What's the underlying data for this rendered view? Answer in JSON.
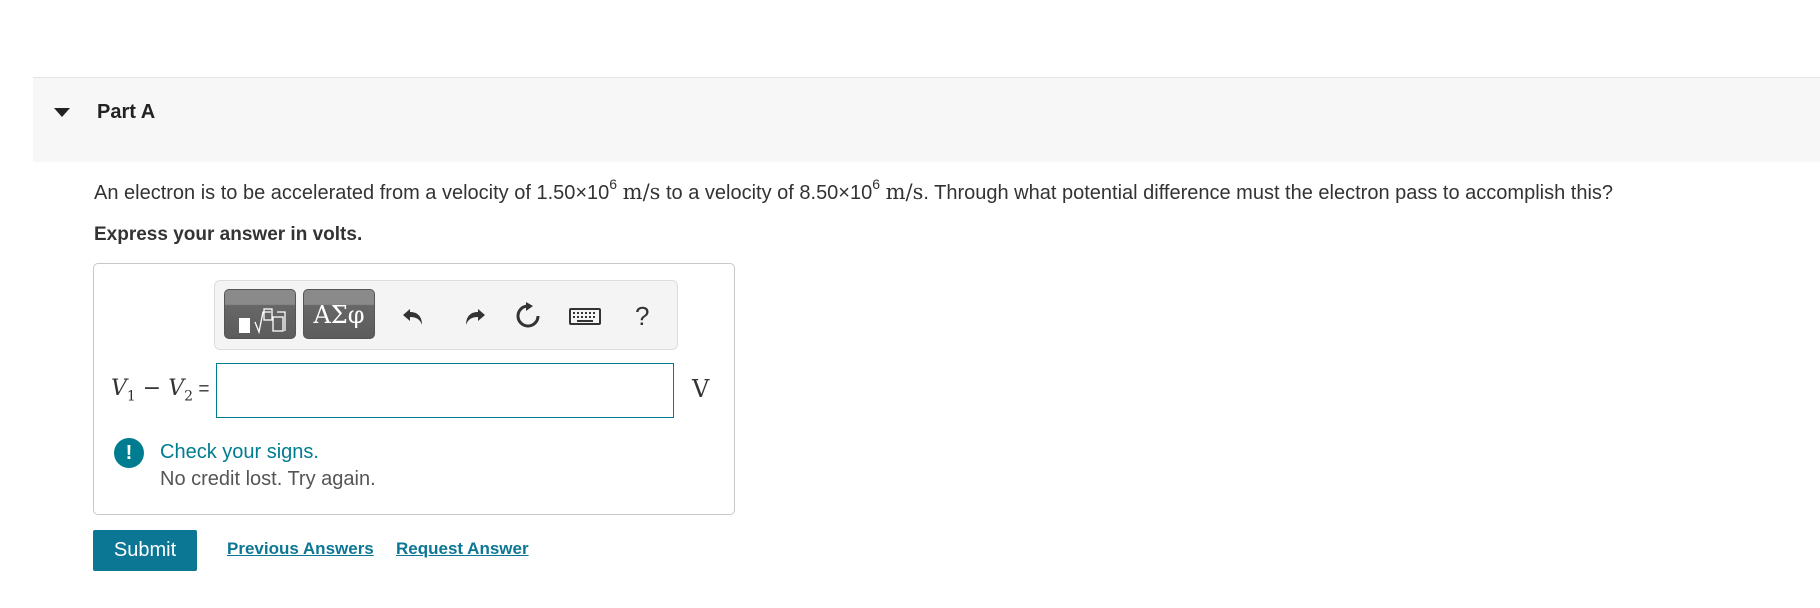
{
  "part": {
    "title": "Part A",
    "caret_icon": "caret-down-icon"
  },
  "question": {
    "prefix": "An electron is to be accelerated from a velocity of 1.50×10",
    "exp1": "6",
    "unit1": "m/s",
    "middle": "to a velocity of 8.50×10",
    "exp2": "6",
    "unit2": "m/s",
    "suffix": ". Through what potential difference must the electron pass to accomplish this?"
  },
  "instruction": "Express your answer in volts.",
  "toolbar": {
    "template_icon": "templates-icon",
    "greek_label": "ΑΣφ",
    "undo_icon": "undo-icon",
    "redo_icon": "redo-icon",
    "reset_icon": "reset-icon",
    "keyboard_icon": "keyboard-icon",
    "help_label": "?"
  },
  "answer": {
    "label_v1": "V",
    "label_sub1": "1",
    "label_minus": " − ",
    "label_v2": "V",
    "label_sub2": "2",
    "label_equals": " =",
    "value": "",
    "unit": "V"
  },
  "feedback": {
    "icon": "!",
    "title": "Check your signs.",
    "subtitle": "No credit lost. Try again."
  },
  "actions": {
    "submit_label": "Submit",
    "previous_answers_label": "Previous Answers",
    "request_answer_label": "Request Answer"
  },
  "colors": {
    "accent": "#007c91",
    "button": "#0b7794",
    "header_bg": "#f7f7f7"
  }
}
